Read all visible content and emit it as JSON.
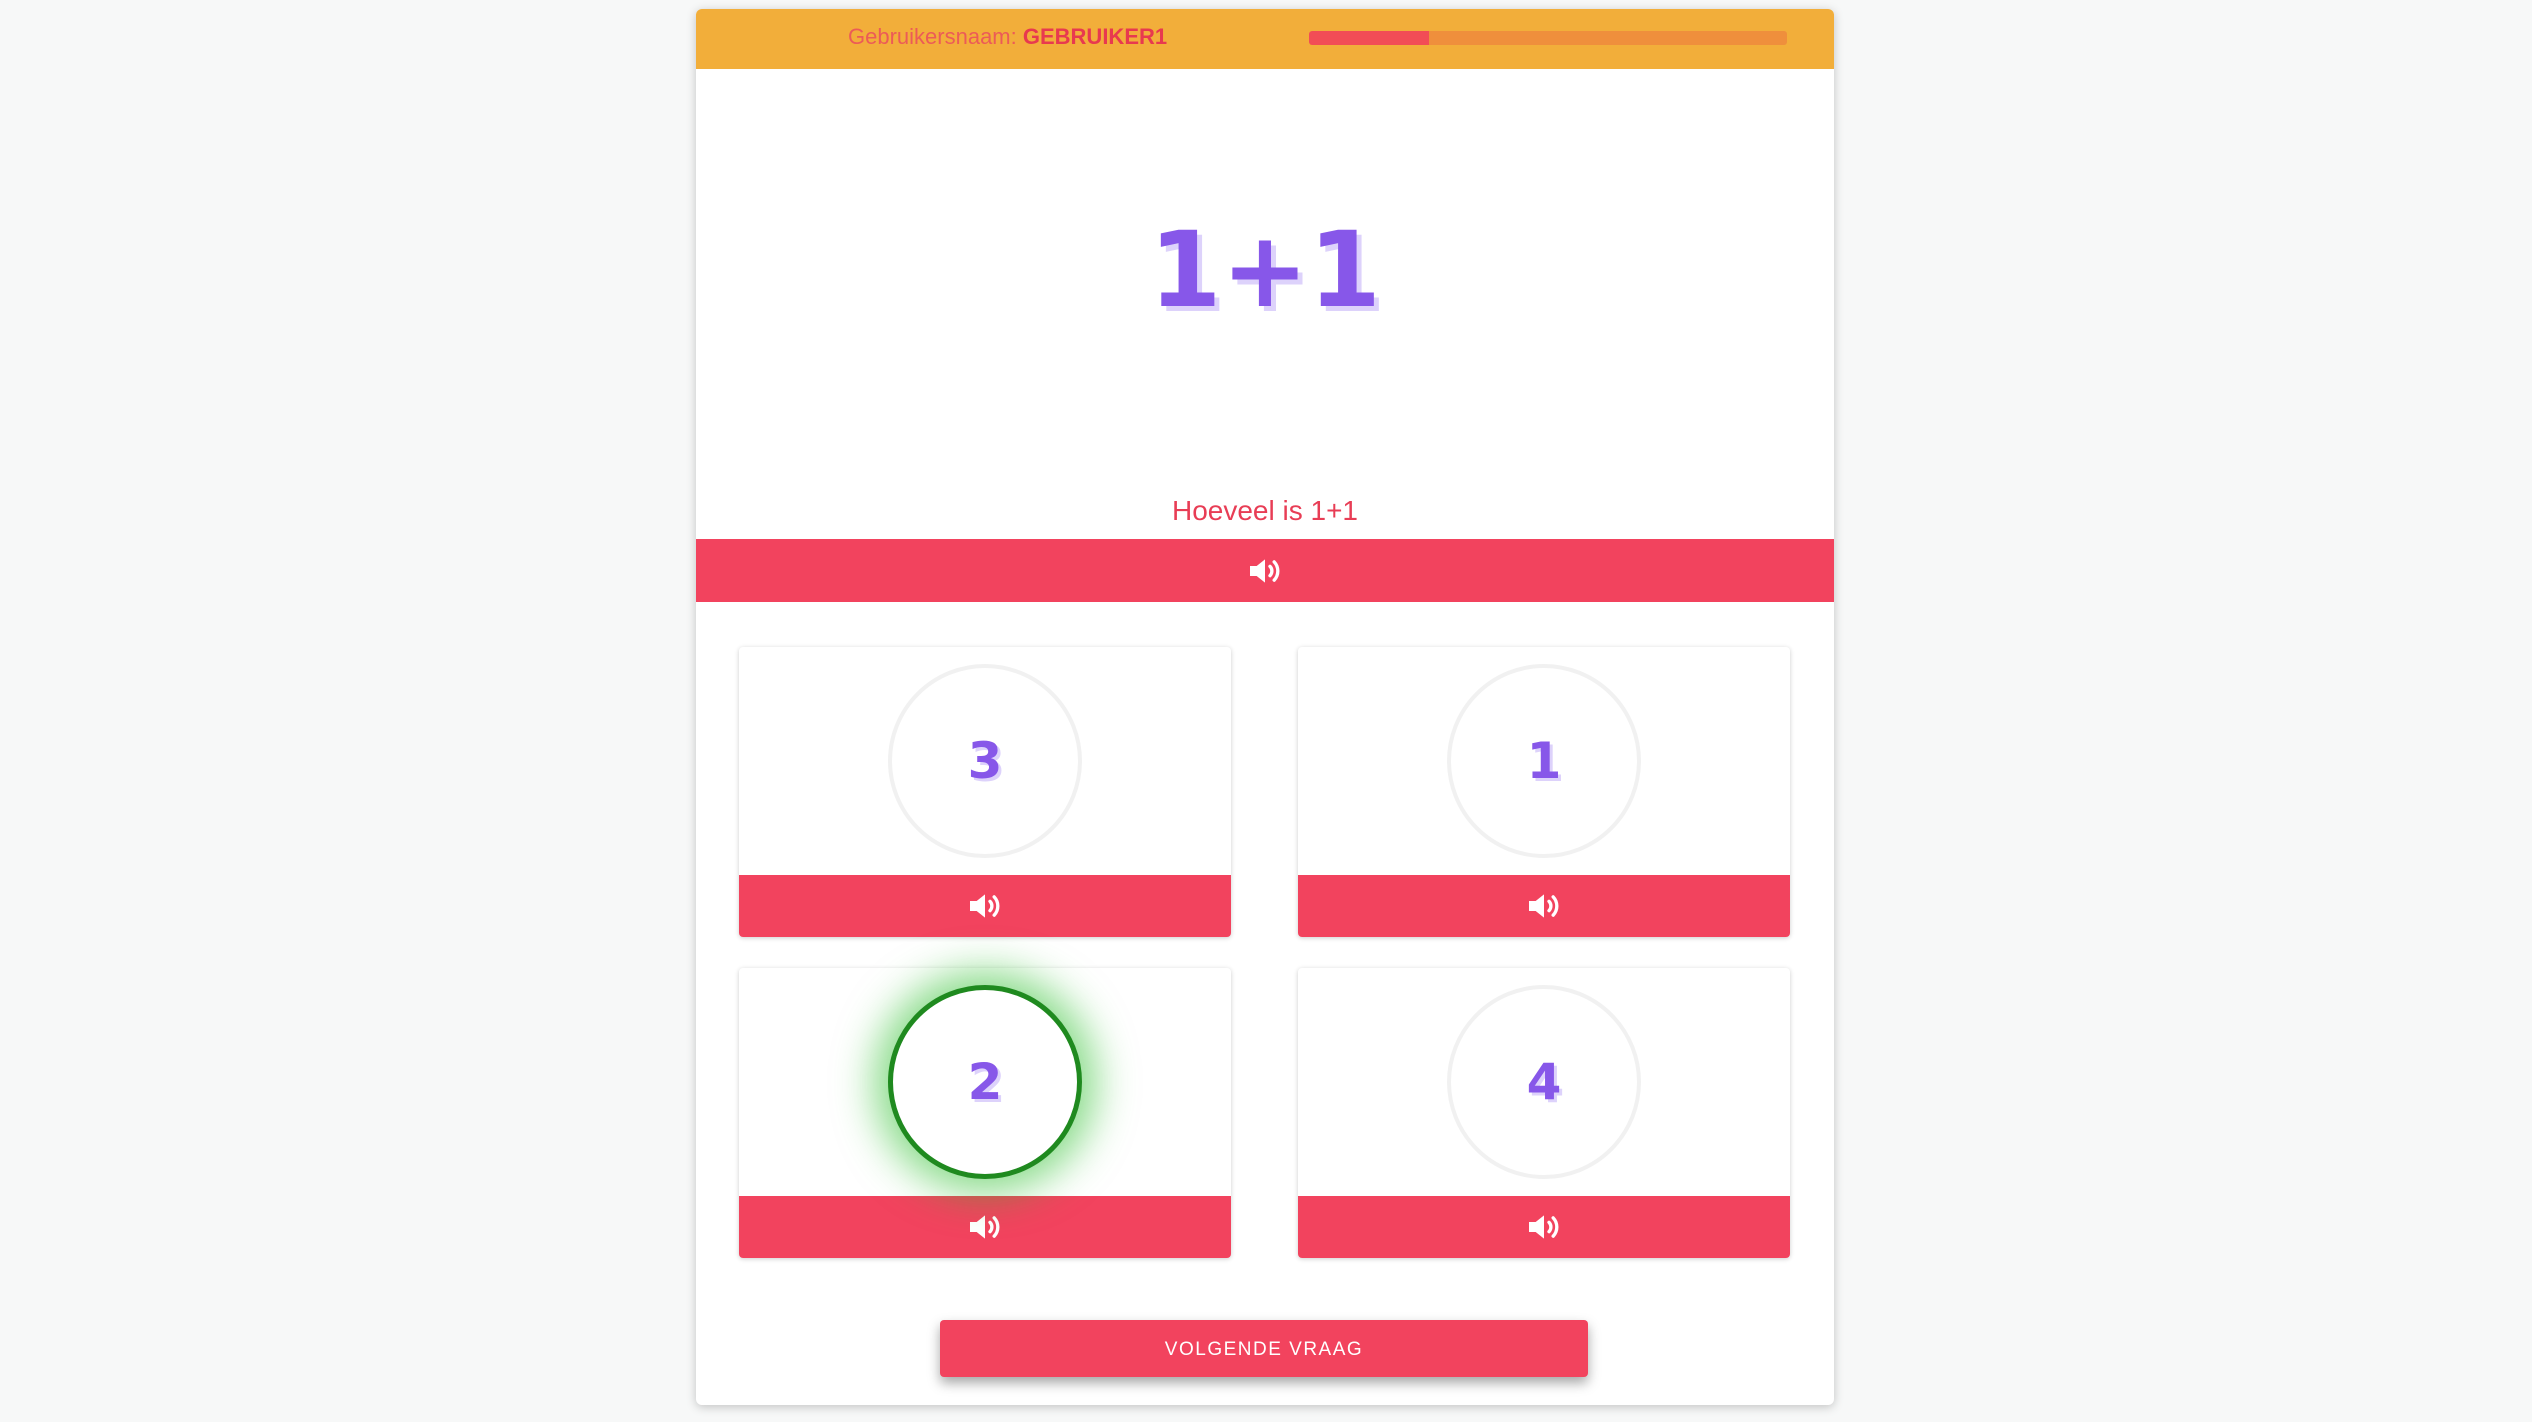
{
  "header": {
    "username_label": "Gebruikersnaam:",
    "username_value": "GEBRUIKER1",
    "progress": 0.25
  },
  "question": {
    "expression": "1+1",
    "prompt": "Hoeveel is 1+1",
    "audio_icon": "speaker-icon"
  },
  "answers": [
    {
      "value": "3",
      "audio_icon": "speaker-icon",
      "selected": false
    },
    {
      "value": "1",
      "audio_icon": "speaker-icon",
      "selected": false
    },
    {
      "value": "2",
      "audio_icon": "speaker-icon",
      "selected": true
    },
    {
      "value": "4",
      "audio_icon": "speaker-icon",
      "selected": false
    }
  ],
  "actions": {
    "next_label": "VOLGENDE VRAAG"
  },
  "colors": {
    "topbar": "#f2ae3a",
    "accent": "#f2435e",
    "purple": "#8757e9",
    "selected_green": "#1f8a1f"
  }
}
